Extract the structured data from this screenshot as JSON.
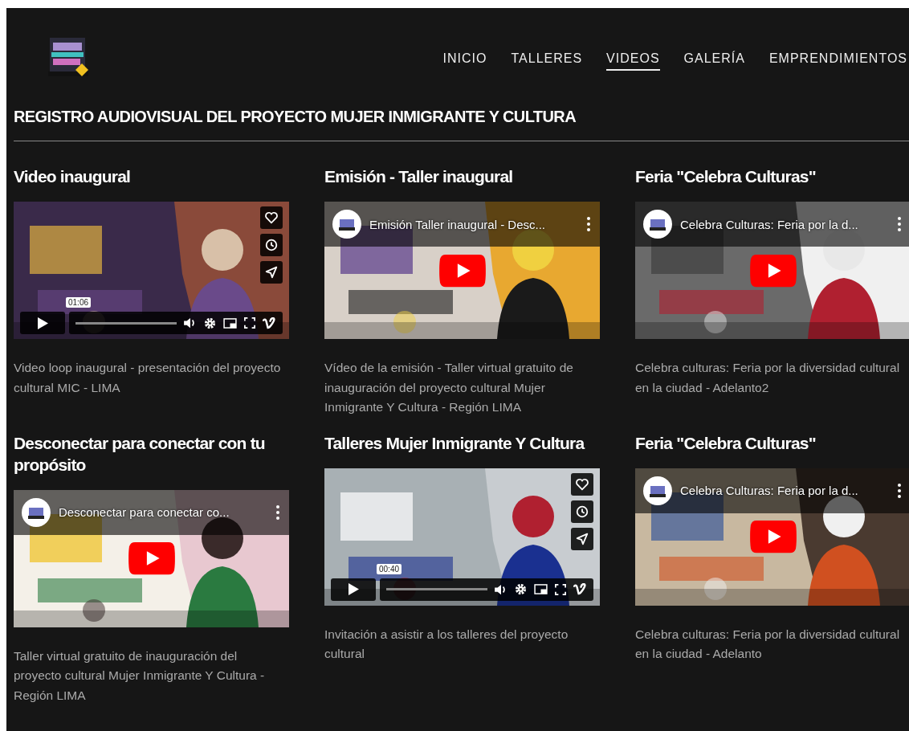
{
  "nav": [
    {
      "label": "INICIO",
      "selected": false
    },
    {
      "label": "TALLERES",
      "selected": false
    },
    {
      "label": "VIDEOS",
      "selected": true
    },
    {
      "label": "GALERÍA",
      "selected": false
    },
    {
      "label": "EMPRENDIMIENTOS",
      "selected": false
    }
  ],
  "heading": "REGISTRO AUDIOVISUAL DEL PROYECTO MUJER INMIGRANTE Y CULTURA",
  "videos": [
    {
      "title": "Video inaugural",
      "kind": "vimeo",
      "timestamp": "01:06",
      "description": "Video loop inaugural - presentación del proyecto cultural MIC - LIMA"
    },
    {
      "title": "Emisión - Taller inaugural",
      "kind": "youtube",
      "player_title": "Emisión Taller inaugural - Desc...",
      "description": "Vídeo de la emisión - Taller virtual gratuito de inauguración del proyecto cultural Mujer Inmigrante Y Cultura - Región LIMA"
    },
    {
      "title": "Feria \"Celebra Culturas\"",
      "kind": "youtube",
      "player_title": "Celebra Culturas: Feria por la d...",
      "description": "Celebra culturas: Feria por la diversidad cultural en la ciudad - Adelanto2"
    },
    {
      "title": "Desconectar para conectar con tu propósito",
      "kind": "youtube",
      "player_title": "Desconectar para conectar co...",
      "description": "Taller virtual gratuito de inauguración del proyecto cultural Mujer Inmigrante Y Cultura - Región LIMA"
    },
    {
      "title": "Talleres Mujer Inmigrante Y Cultura",
      "kind": "vimeo",
      "timestamp": "00:40",
      "description": "Invitación a asistir a los talleres del proyecto cultural"
    },
    {
      "title": "Feria \"Celebra Culturas\"",
      "kind": "youtube",
      "player_title": "Celebra Culturas: Feria por la d...",
      "description": "Celebra culturas: Feria por la diversidad cultural en la ciudad - Adelanto"
    }
  ]
}
